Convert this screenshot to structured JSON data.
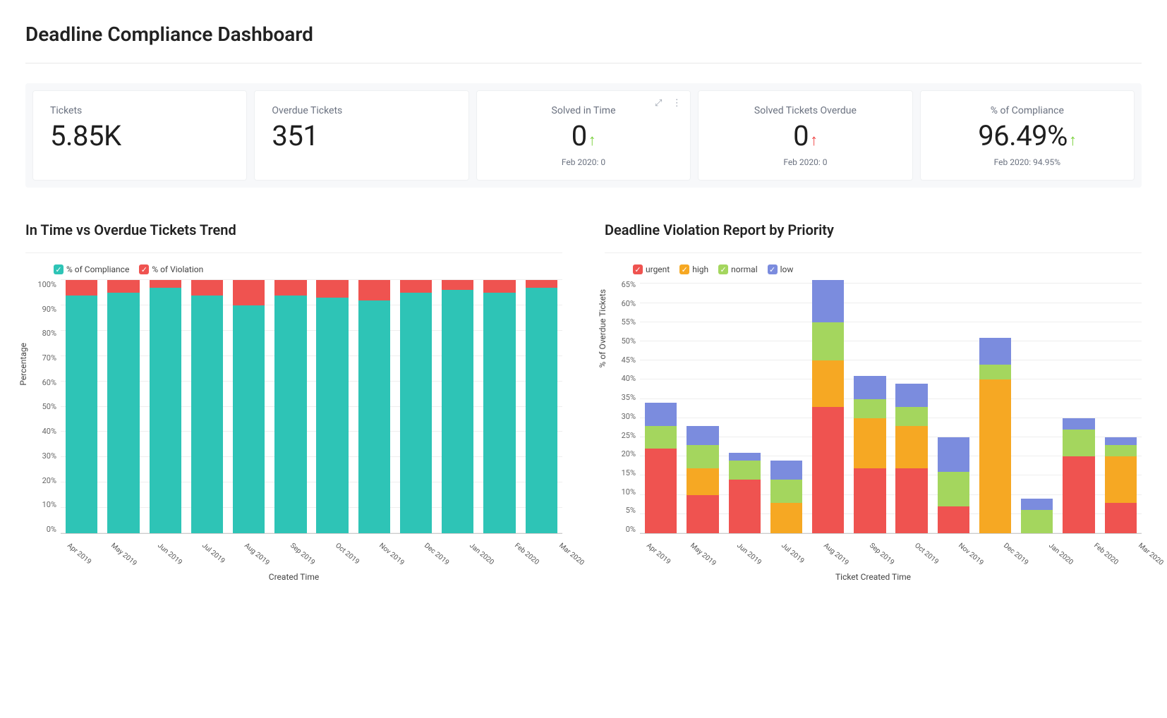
{
  "title": "Deadline Compliance Dashboard",
  "kpis": [
    {
      "label": "Tickets",
      "value": "5.85K",
      "sub": "",
      "arrow": "",
      "align": "left"
    },
    {
      "label": "Overdue Tickets",
      "value": "351",
      "sub": "",
      "arrow": "",
      "align": "left"
    },
    {
      "label": "Solved in Time",
      "value": "0",
      "sub": "Feb 2020: 0",
      "arrow": "green",
      "align": "center",
      "actions": true
    },
    {
      "label": "Solved Tickets Overdue",
      "value": "0",
      "sub": "Feb 2020: 0",
      "arrow": "red",
      "align": "center"
    },
    {
      "label": "% of Compliance",
      "value": "96.49%",
      "sub": "Feb 2020: 94.95%",
      "arrow": "green",
      "align": "center"
    }
  ],
  "chart1": {
    "title": "In Time vs Overdue Tickets Trend",
    "legend": [
      {
        "label": "% of Compliance",
        "color": "c-teal"
      },
      {
        "label": "% of Violation",
        "color": "c-red"
      }
    ],
    "ylabel": "Percentage",
    "xlabel": "Created Time"
  },
  "chart2": {
    "title": "Deadline Violation Report by Priority",
    "legend": [
      {
        "label": "urgent",
        "color": "c-red"
      },
      {
        "label": "high",
        "color": "c-orange"
      },
      {
        "label": "normal",
        "color": "c-green"
      },
      {
        "label": "low",
        "color": "c-blue"
      }
    ],
    "ylabel": "% of Overdue Tickets",
    "xlabel": "Ticket Created Time"
  },
  "chart_data": [
    {
      "type": "bar",
      "stacked": true,
      "title": "In Time vs Overdue Tickets Trend",
      "xlabel": "Created Time",
      "ylabel": "Percentage",
      "ylim": [
        0,
        100
      ],
      "yticks": [
        0,
        10,
        20,
        30,
        40,
        50,
        60,
        70,
        80,
        90,
        100
      ],
      "categories": [
        "Apr 2019",
        "May 2019",
        "Jun 2019",
        "Jul 2019",
        "Aug 2019",
        "Sep 2019",
        "Oct 2019",
        "Nov 2019",
        "Dec 2019",
        "Jan 2020",
        "Feb 2020",
        "Mar 2020"
      ],
      "series": [
        {
          "name": "% of Compliance",
          "color": "#2ec4b6",
          "values": [
            94,
            95,
            97,
            94,
            90,
            94,
            93,
            92,
            95,
            96,
            95,
            97
          ]
        },
        {
          "name": "% of Violation",
          "color": "#ef5350",
          "values": [
            6,
            5,
            3,
            6,
            10,
            6,
            7,
            8,
            5,
            4,
            5,
            3
          ]
        }
      ]
    },
    {
      "type": "bar",
      "stacked": true,
      "title": "Deadline Violation Report by Priority",
      "xlabel": "Ticket Created Time",
      "ylabel": "% of Overdue Tickets",
      "ylim": [
        0,
        66
      ],
      "yticks": [
        0,
        5,
        10,
        15,
        20,
        25,
        30,
        35,
        40,
        45,
        50,
        55,
        60,
        65
      ],
      "categories": [
        "Apr 2019",
        "May 2019",
        "Jun 2019",
        "Jul 2019",
        "Aug 2019",
        "Sep 2019",
        "Oct 2019",
        "Nov 2019",
        "Dec 2019",
        "Jan 2020",
        "Feb 2020",
        "Mar 2020"
      ],
      "series": [
        {
          "name": "urgent",
          "color": "#ef5350",
          "values": [
            22,
            10,
            14,
            0,
            33,
            17,
            17,
            7,
            0,
            0,
            20,
            8
          ]
        },
        {
          "name": "high",
          "color": "#f6a823",
          "values": [
            0,
            7,
            0,
            8,
            12,
            13,
            11,
            0,
            40,
            0,
            0,
            12
          ]
        },
        {
          "name": "normal",
          "color": "#a4d65e",
          "values": [
            6,
            6,
            5,
            6,
            10,
            5,
            5,
            9,
            4,
            6,
            7,
            3
          ]
        },
        {
          "name": "low",
          "color": "#7b8cde",
          "values": [
            6,
            5,
            2,
            5,
            11,
            6,
            6,
            9,
            7,
            3,
            3,
            2
          ]
        }
      ]
    }
  ]
}
